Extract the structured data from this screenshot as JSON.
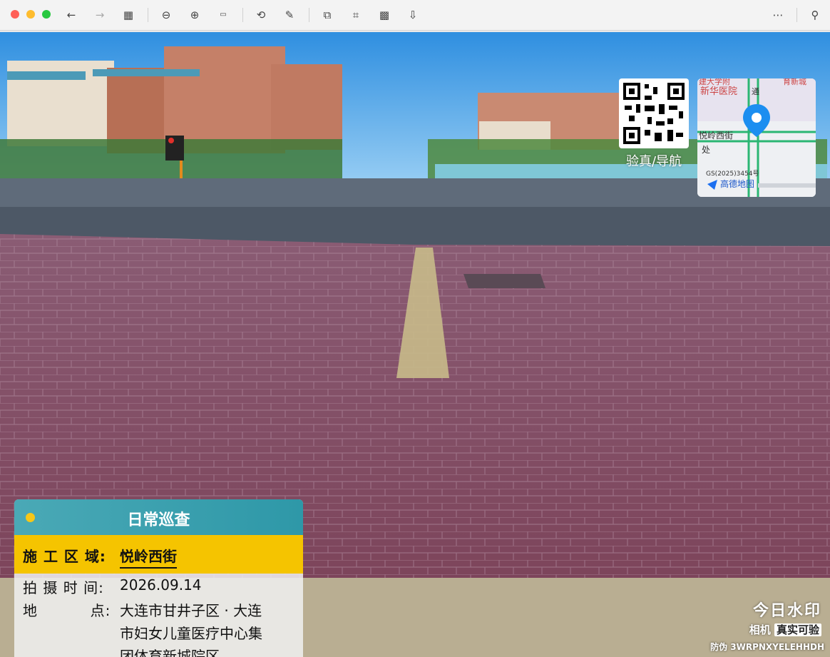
{
  "toolbar": {
    "traffic_lights": [
      "#ff5f57",
      "#febc2e",
      "#28c840"
    ],
    "icons": [
      "back-icon",
      "forward-icon",
      "grid-icon",
      "zoom-out-icon",
      "zoom-in-icon",
      "actual-size-icon",
      "rotate-icon",
      "markup-icon",
      "resize-icon",
      "crop-icon",
      "qr-icon",
      "export-icon",
      "more-icon",
      "pin-icon"
    ]
  },
  "overlay": {
    "qr_label": "验真/导航",
    "map": {
      "labels": [
        "通",
        "新华医院",
        "悦岭西街",
        "处",
        "GS(2025)3454号",
        "高德地图"
      ]
    },
    "card": {
      "title": "日常巡查",
      "area_label": "施 工 区 域:",
      "area_value": "悦岭西街",
      "time_label": "拍 摄 时 间:",
      "time_value": "2026.09.14",
      "place_label": "地          点:",
      "place_lines": [
        "大连市甘井子区 · 大连",
        "市妇女儿童医疗中心集",
        "团体育新城院区"
      ]
    },
    "watermark": {
      "main": "今日水印",
      "sub_text": "相机",
      "sub_box": "真实可验",
      "code": "防伪 3WRPNXYELEHHDH"
    }
  },
  "colors": {
    "sky": "#4aa8e8",
    "paving": "#8a4b63",
    "card_yellow": "#f5c400",
    "card_head": "#3aa3b1"
  }
}
